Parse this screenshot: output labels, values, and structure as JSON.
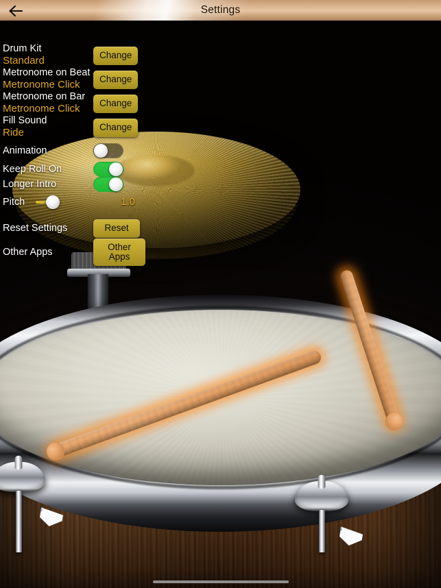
{
  "header": {
    "title": "Settings",
    "back_icon": "arrow-left-icon"
  },
  "settings": {
    "rows": [
      {
        "label": "Drum Kit",
        "value": "Standard",
        "action": "Change"
      },
      {
        "label": "Metronome on Beat",
        "value": "Metronome Click",
        "action": "Change"
      },
      {
        "label": "Metronome on Bar",
        "value": "Metronome Click",
        "action": "Change"
      },
      {
        "label": "Fill Sound",
        "value": "Ride",
        "action": "Change"
      }
    ],
    "toggles": [
      {
        "label": "Animation",
        "state": "off"
      },
      {
        "label": "Keep Roll On",
        "state": "on"
      },
      {
        "label": "Longer Intro",
        "state": "on"
      }
    ],
    "pitch": {
      "label": "Pitch",
      "value": "1.0"
    },
    "reset": {
      "label": "Reset Settings",
      "button": "Reset"
    },
    "other_apps": {
      "label": "Other Apps",
      "button": "Other Apps"
    }
  },
  "colors": {
    "gold_text": "#e3a81f",
    "gold_button": "#bda42d",
    "toggle_on": "#22b835",
    "header_bronze": "#d8b08a",
    "white_text": "#ffffff"
  },
  "scene": {
    "description": "drum-kit-background",
    "elements": [
      "ride-cymbal",
      "cymbal-stand",
      "snare-drum",
      "drumsticks",
      "wooden-shell"
    ]
  }
}
